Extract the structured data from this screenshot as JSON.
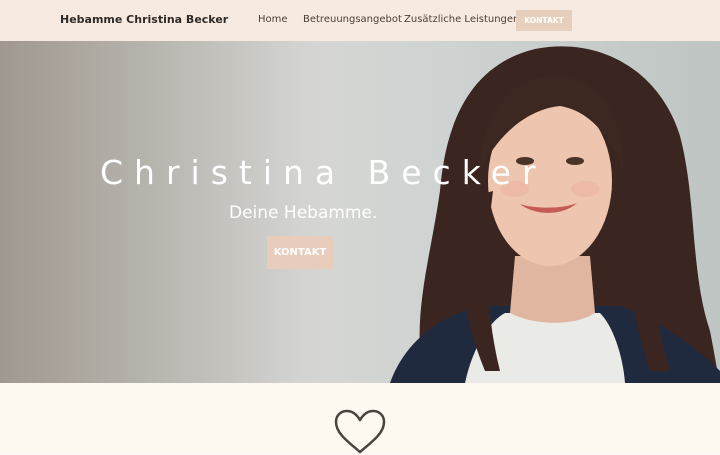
{
  "header": {
    "brand": "Hebamme Christina Becker",
    "nav": [
      {
        "label": "Home"
      },
      {
        "label": "Betreuungsangebot"
      },
      {
        "label": "Zusätzliche Leistungen",
        "has_dropdown": true,
        "icon": "chevron-down-icon"
      }
    ],
    "cta_label": "KONTAKT"
  },
  "hero": {
    "title": "Christina Becker",
    "subtitle": "Deine Hebamme.",
    "button_label": "KONTAKT",
    "image": "portrait-photo"
  },
  "section": {
    "icon": "heart-icon"
  },
  "colors": {
    "header_bg": "#f7ebe1",
    "accent": "#e7cfbd",
    "section_bg": "#fdf8f0"
  }
}
